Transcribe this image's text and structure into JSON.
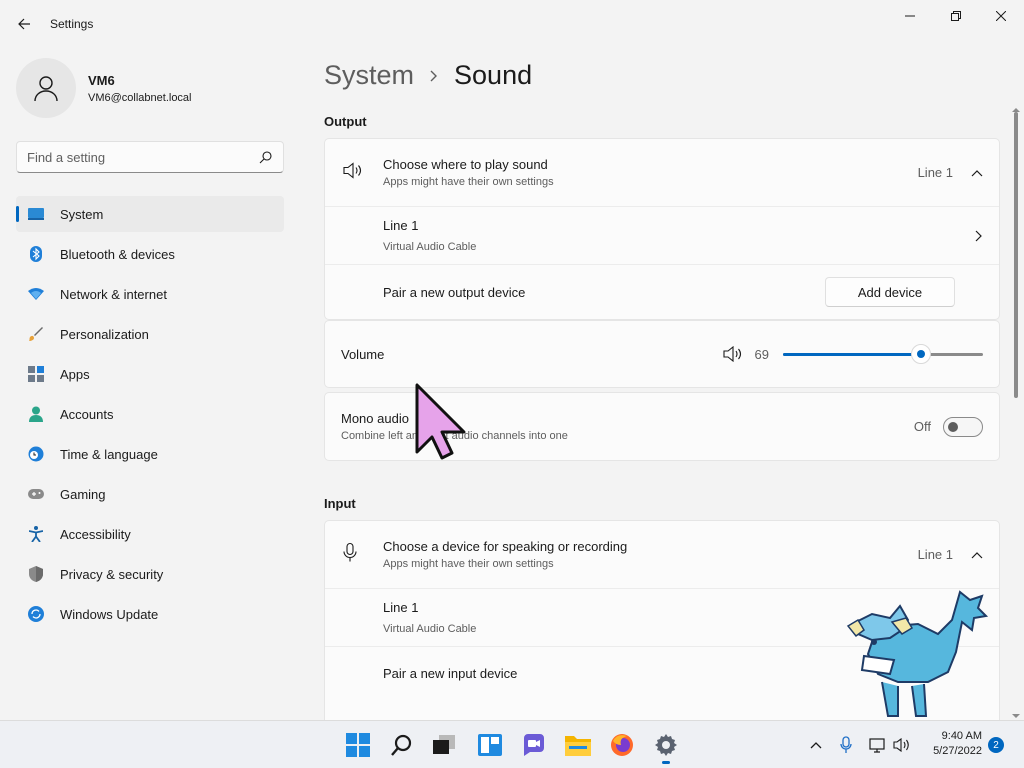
{
  "window": {
    "title": "Settings"
  },
  "profile": {
    "name": "VM6",
    "email": "VM6@collabnet.local"
  },
  "search": {
    "placeholder": "Find a setting"
  },
  "nav": [
    {
      "label": "System",
      "icon": "monitor-icon",
      "active": true
    },
    {
      "label": "Bluetooth & devices",
      "icon": "bluetooth-icon"
    },
    {
      "label": "Network & internet",
      "icon": "wifi-icon"
    },
    {
      "label": "Personalization",
      "icon": "brush-icon"
    },
    {
      "label": "Apps",
      "icon": "apps-icon"
    },
    {
      "label": "Accounts",
      "icon": "person-icon"
    },
    {
      "label": "Time & language",
      "icon": "clock-globe-icon"
    },
    {
      "label": "Gaming",
      "icon": "gamepad-icon"
    },
    {
      "label": "Accessibility",
      "icon": "accessibility-icon"
    },
    {
      "label": "Privacy & security",
      "icon": "shield-icon"
    },
    {
      "label": "Windows Update",
      "icon": "update-icon"
    }
  ],
  "breadcrumb": {
    "parent": "System",
    "current": "Sound"
  },
  "output": {
    "label": "Output",
    "choose_title": "Choose where to play sound",
    "choose_sub": "Apps might have their own settings",
    "choose_value": "Line 1",
    "device_name": "Line 1",
    "device_sub": "Virtual Audio Cable",
    "pair_label": "Pair a new output device",
    "add_button": "Add device"
  },
  "volume": {
    "label": "Volume",
    "value": "69",
    "level": 69
  },
  "mono": {
    "title": "Mono audio",
    "sub": "Combine left and right audio channels into one",
    "state": "Off"
  },
  "input": {
    "label": "Input",
    "choose_title": "Choose a device for speaking or recording",
    "choose_sub": "Apps might have their own settings",
    "choose_value": "Line 1",
    "device_name": "Line 1",
    "device_sub": "Virtual Audio Cable",
    "pair_label": "Pair a new input device"
  },
  "taskbar": {
    "time": "9:40 AM",
    "date": "5/27/2022",
    "notifications": "2",
    "apps": [
      "start-icon",
      "search-icon",
      "task-view-icon",
      "widgets-icon",
      "chat-icon",
      "file-explorer-icon",
      "firefox-icon",
      "settings-icon"
    ]
  },
  "colors": {
    "accent": "#0067c0"
  }
}
